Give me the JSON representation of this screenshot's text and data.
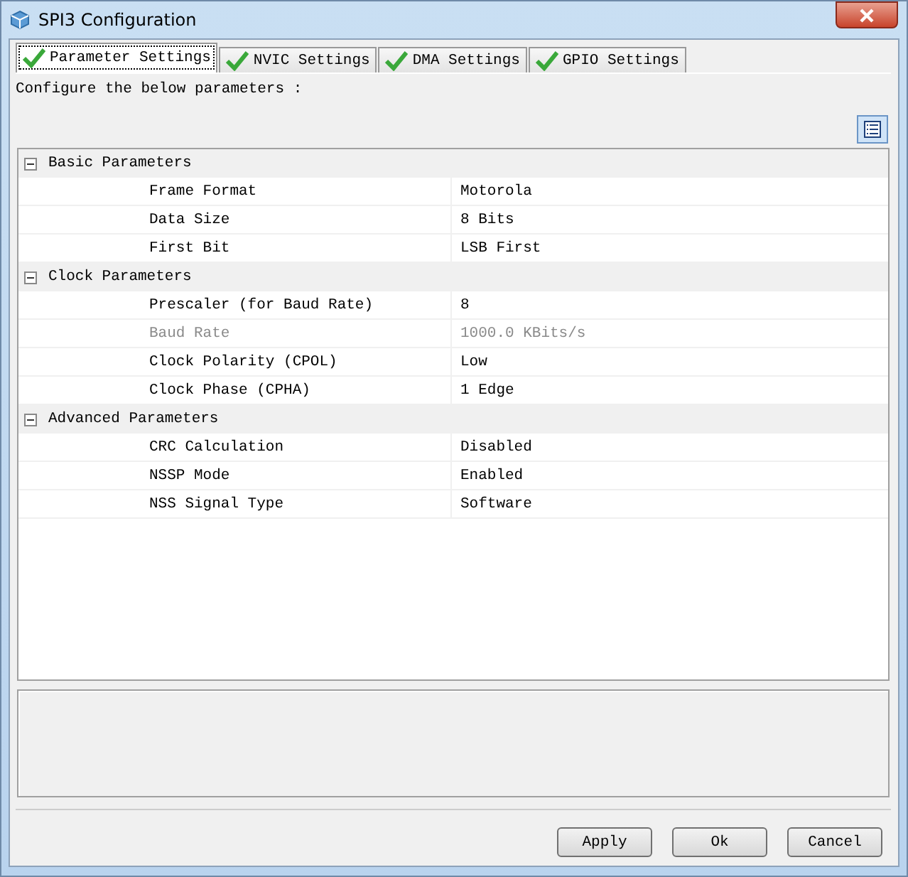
{
  "window": {
    "title": "SPI3 Configuration"
  },
  "tabs": [
    {
      "label": "Parameter Settings",
      "selected": true,
      "valid": true
    },
    {
      "label": "NVIC Settings",
      "selected": false,
      "valid": true
    },
    {
      "label": "DMA Settings",
      "selected": false,
      "valid": true
    },
    {
      "label": "GPIO Settings",
      "selected": false,
      "valid": true
    }
  ],
  "instruction": "Configure the below parameters :",
  "groups": [
    {
      "label": "Basic Parameters",
      "expanded": true,
      "children": [
        {
          "name": "Frame Format",
          "value": "Motorola",
          "disabled": false
        },
        {
          "name": "Data Size",
          "value": "8 Bits",
          "disabled": false
        },
        {
          "name": "First Bit",
          "value": "LSB First",
          "disabled": false
        }
      ]
    },
    {
      "label": "Clock Parameters",
      "expanded": true,
      "children": [
        {
          "name": "Prescaler (for Baud Rate)",
          "value": "8",
          "disabled": false
        },
        {
          "name": "Baud Rate",
          "value": "1000.0 KBits/s",
          "disabled": true
        },
        {
          "name": "Clock Polarity (CPOL)",
          "value": "Low",
          "disabled": false
        },
        {
          "name": "Clock Phase (CPHA)",
          "value": "1 Edge",
          "disabled": false
        }
      ]
    },
    {
      "label": "Advanced Parameters",
      "expanded": true,
      "children": [
        {
          "name": "CRC Calculation",
          "value": "Disabled",
          "disabled": false
        },
        {
          "name": "NSSP Mode",
          "value": "Enabled",
          "disabled": false
        },
        {
          "name": "NSS Signal Type",
          "value": "Software",
          "disabled": false
        }
      ]
    }
  ],
  "buttons": [
    "Apply",
    "Ok",
    "Cancel"
  ]
}
